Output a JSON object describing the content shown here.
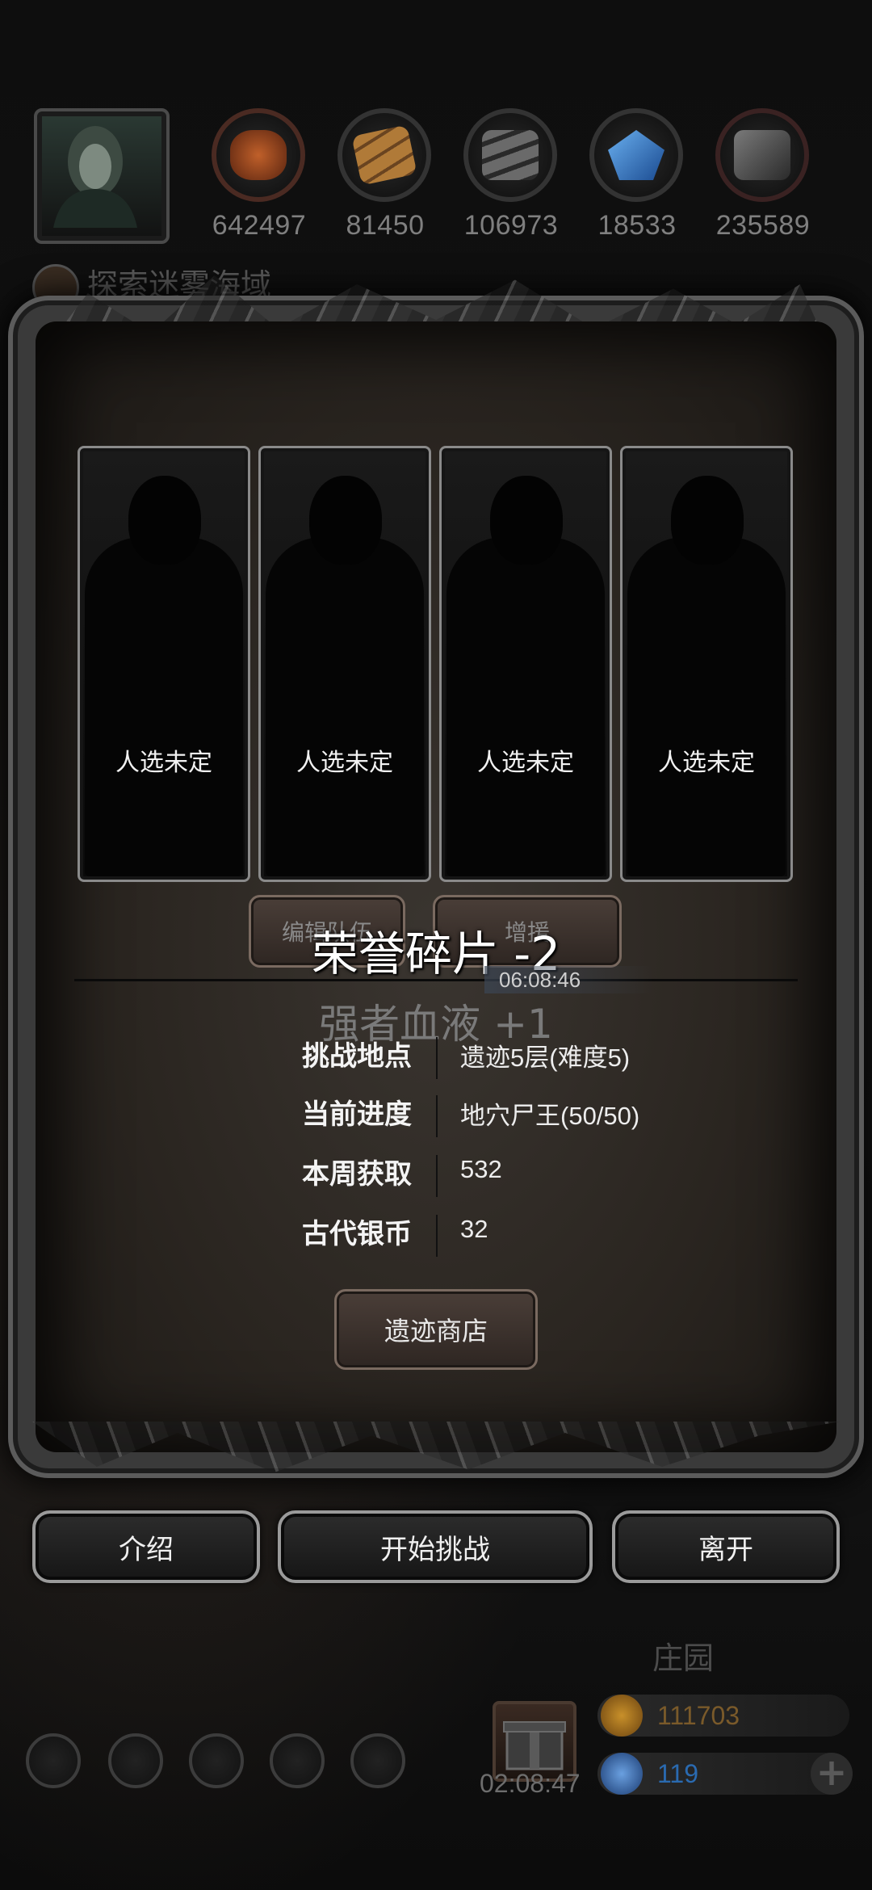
{
  "resources": [
    {
      "icon": "fist-icon",
      "value": "642497",
      "color": "#8a3a1a"
    },
    {
      "icon": "wood-planks-icon",
      "value": "81450",
      "color": "#9a6a30"
    },
    {
      "icon": "iron-ingot-icon",
      "value": "106973",
      "color": "#555555"
    },
    {
      "icon": "crystal-icon",
      "value": "18533",
      "color": "#2a70c0"
    },
    {
      "icon": "stone-block-icon",
      "value": "235589",
      "color": "#4a4a4a"
    }
  ],
  "explore_label": "探索迷雾海域",
  "slots": [
    {
      "label": "人选未定"
    },
    {
      "label": "人选未定"
    },
    {
      "label": "人选未定"
    },
    {
      "label": "人选未定"
    }
  ],
  "team_buttons": {
    "edit": "编辑队伍",
    "boost": "增援"
  },
  "notifications": {
    "primary": "荣誉碎片 -2",
    "timer": "06:08:46",
    "secondary": "强者血液 +1"
  },
  "info": [
    {
      "key": "挑战地点",
      "value": "遗迹5层(难度5)"
    },
    {
      "key": "当前进度",
      "value": "地穴尸王(50/50)"
    },
    {
      "key": "本周获取",
      "value": "532"
    },
    {
      "key": "古代银币",
      "value": "32"
    }
  ],
  "shop_button": "遗迹商店",
  "actions": {
    "intro": "介绍",
    "start": "开始挑战",
    "leave": "离开"
  },
  "hud": {
    "estate_label": "庄园",
    "gold": "111703",
    "gems": "119",
    "gift_timer": "02:08:47",
    "plus": "+"
  },
  "colors": {
    "gold_text": "#7a5a2a",
    "gem_text": "#2a6ab0",
    "panel": "#2e2924"
  }
}
